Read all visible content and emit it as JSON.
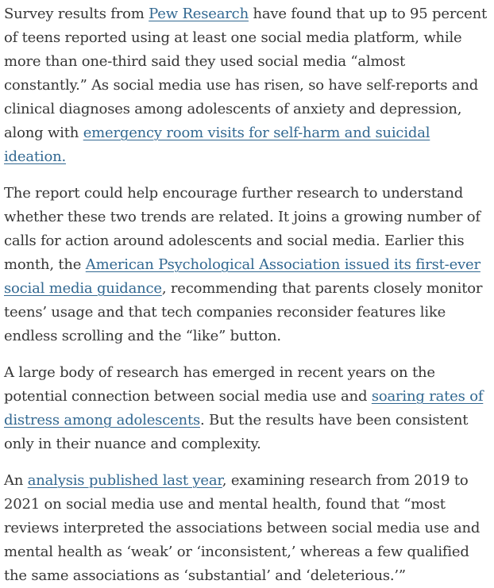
{
  "paragraphs": [
    {
      "segments": [
        {
          "text": "Survey results from "
        },
        {
          "text": "Pew Research",
          "link": true,
          "name": "pew-research-link"
        },
        {
          "text": " have found that up to 95 percent of teens reported using at least one social media platform, while more than one-third said they used social media “almost constantly.” As social media use has risen, so have self-reports and clinical diagnoses among adolescents of anxiety and depression, along with "
        },
        {
          "text": "emergency room visits for self-harm and suicidal ideation.",
          "link": true,
          "name": "emergency-room-visits-link"
        }
      ]
    },
    {
      "segments": [
        {
          "text": "The report could help encourage further research to understand whether these two trends are related. It joins a growing number of calls for action around adolescents and social media. Earlier this month, the "
        },
        {
          "text": "American Psychological Association issued its first-ever social media guidance",
          "link": true,
          "name": "apa-guidance-link"
        },
        {
          "text": ", recommending that parents closely monitor teens’ usage and that tech companies reconsider features like endless scrolling and the “like” button."
        }
      ]
    },
    {
      "segments": [
        {
          "text": "A large body of research has emerged in recent years on the potential connection between social media use and "
        },
        {
          "text": "soaring rates of distress among adolescents",
          "link": true,
          "name": "soaring-rates-link"
        },
        {
          "text": ". But the results have been consistent only in their nuance and complexity."
        }
      ]
    },
    {
      "segments": [
        {
          "text": "An "
        },
        {
          "text": "analysis published last year",
          "link": true,
          "name": "analysis-link"
        },
        {
          "text": ", examining research from 2019 to 2021 on social media use and mental health, found that “most reviews interpreted the associations between social media use and mental health as ‘weak’ or ‘inconsistent,’ whereas a few qualified the same associations as ‘substantial’ and ‘deleterious.’”"
        }
      ]
    }
  ]
}
